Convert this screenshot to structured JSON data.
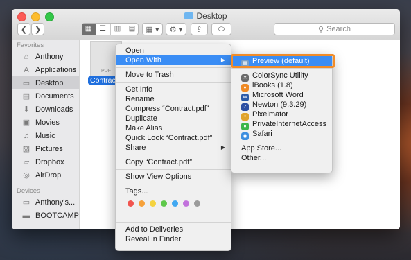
{
  "window": {
    "title": "Desktop"
  },
  "toolbar": {
    "back": "❮",
    "forward": "❯",
    "views": [
      "▦",
      "☰",
      "▥",
      "▤"
    ],
    "group": "▦ ▾",
    "action": "⚙ ▾",
    "share": "⇪",
    "tag": "⬭",
    "search_placeholder": "Search"
  },
  "sidebar": {
    "favorites_header": "Favorites",
    "favorites": [
      {
        "label": "Anthony",
        "icon": "⌂"
      },
      {
        "label": "Applications",
        "icon": "A"
      },
      {
        "label": "Desktop",
        "icon": "▭"
      },
      {
        "label": "Documents",
        "icon": "▤"
      },
      {
        "label": "Downloads",
        "icon": "⬇"
      },
      {
        "label": "Movies",
        "icon": "▣"
      },
      {
        "label": "Music",
        "icon": "♫"
      },
      {
        "label": "Pictures",
        "icon": "▨"
      },
      {
        "label": "Dropbox",
        "icon": "▱"
      },
      {
        "label": "AirDrop",
        "icon": "◎"
      }
    ],
    "devices_header": "Devices",
    "devices": [
      {
        "label": "Anthony's...",
        "icon": "▭"
      },
      {
        "label": "BOOTCAMP",
        "icon": "▬"
      }
    ]
  },
  "file": {
    "name": "Contract",
    "type": "PDF"
  },
  "context_menu": {
    "open": "Open",
    "open_with": "Open With",
    "move_to_trash": "Move to Trash",
    "get_info": "Get Info",
    "rename": "Rename",
    "compress": "Compress “Contract.pdf”",
    "duplicate": "Duplicate",
    "make_alias": "Make Alias",
    "quick_look": "Quick Look “Contract.pdf”",
    "share": "Share",
    "copy": "Copy “Contract.pdf”",
    "show_view_options": "Show View Options",
    "tags": "Tags...",
    "tag_colors": [
      "#f1554f",
      "#f6a13a",
      "#f5d33f",
      "#5ec84a",
      "#41a8f1",
      "#c272dc",
      "#9b9b9b"
    ],
    "add_to_deliveries": "Add to Deliveries",
    "reveal_in_finder": "Reveal in Finder",
    "arrow": "▶"
  },
  "submenu": {
    "preview": "Preview (default)",
    "apps": [
      {
        "label": "ColorSync Utility",
        "color": "#6b6b6b",
        "glyph": "✕"
      },
      {
        "label": "iBooks (1.8)",
        "color": "#f08a24",
        "glyph": "●"
      },
      {
        "label": "Microsoft Word",
        "color": "#2b5aa8",
        "glyph": "W"
      },
      {
        "label": "Newton (9.3.29)",
        "color": "#2c4fa3",
        "glyph": "✓"
      },
      {
        "label": "Pixelmator",
        "color": "#e0a32b",
        "glyph": "✦"
      },
      {
        "label": "PrivateInternetAccess",
        "color": "#3cb64a",
        "glyph": "●"
      },
      {
        "label": "Safari",
        "color": "#3d8fe0",
        "glyph": "◉"
      }
    ],
    "app_store": "App Store...",
    "other": "Other..."
  }
}
